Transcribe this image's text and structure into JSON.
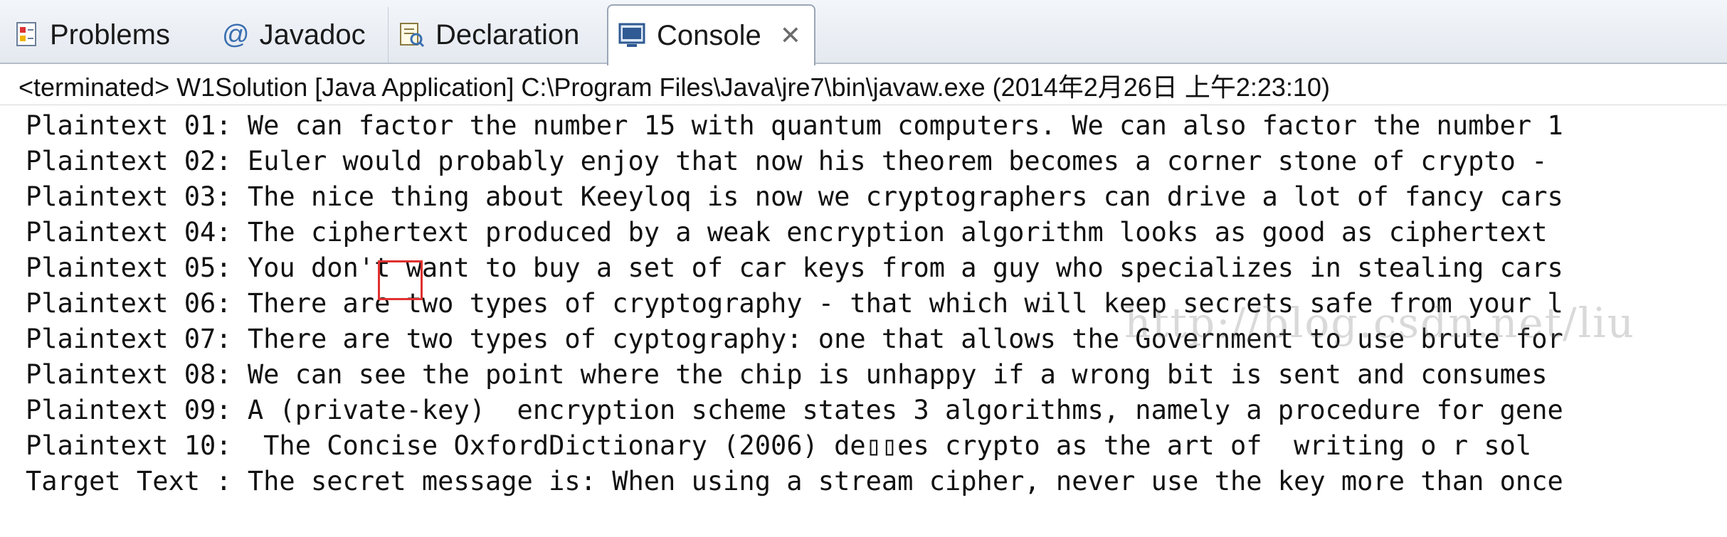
{
  "tabs": [
    {
      "label": "Problems",
      "icon": "problems-icon"
    },
    {
      "label": "Javadoc",
      "icon": "at-icon",
      "icon_glyph": "@"
    },
    {
      "label": "Declaration",
      "icon": "declaration-icon"
    },
    {
      "label": "Console",
      "icon": "console-icon",
      "active": true,
      "close": "✕"
    }
  ],
  "status": "<terminated> W1Solution [Java Application] C:\\Program Files\\Java\\jre7\\bin\\javaw.exe (2014年2月26日 上午2:23:10)",
  "console_lines": [
    "Plaintext 01: We can factor the number 15 with quantum computers. We can also factor the number 1",
    "Plaintext 02: Euler would probably enjoy that now his theorem becomes a corner stone of crypto -",
    "Plaintext 03: The nice thing about Keeyloq is now we cryptographers can drive a lot of fancy cars",
    "Plaintext 04: The ciphertext produced by a weak encryption algorithm looks as good as ciphertext",
    "Plaintext 05: You don't want to buy a set of car keys from a guy who specializes in stealing cars",
    "Plaintext 06: There are two types of cryptography - that which will keep secrets safe from your l",
    "Plaintext 07: There are two types of cyptography: one that allows the Government to use brute for",
    "Plaintext 08: We can see the point where the chip is unhappy if a wrong bit is sent and consumes",
    "Plaintext 09: A (private-key)  encryption scheme states 3 algorithms, namely a procedure for gene",
    "Plaintext 10:  The Concise OxfordDictionary (2006) de▯▯es crypto as the art of  writing o r sol",
    "Target Text : The secret message is: When using a stream cipher, never use the key more than once"
  ],
  "watermark": "http://blog.csdn.net/liu"
}
